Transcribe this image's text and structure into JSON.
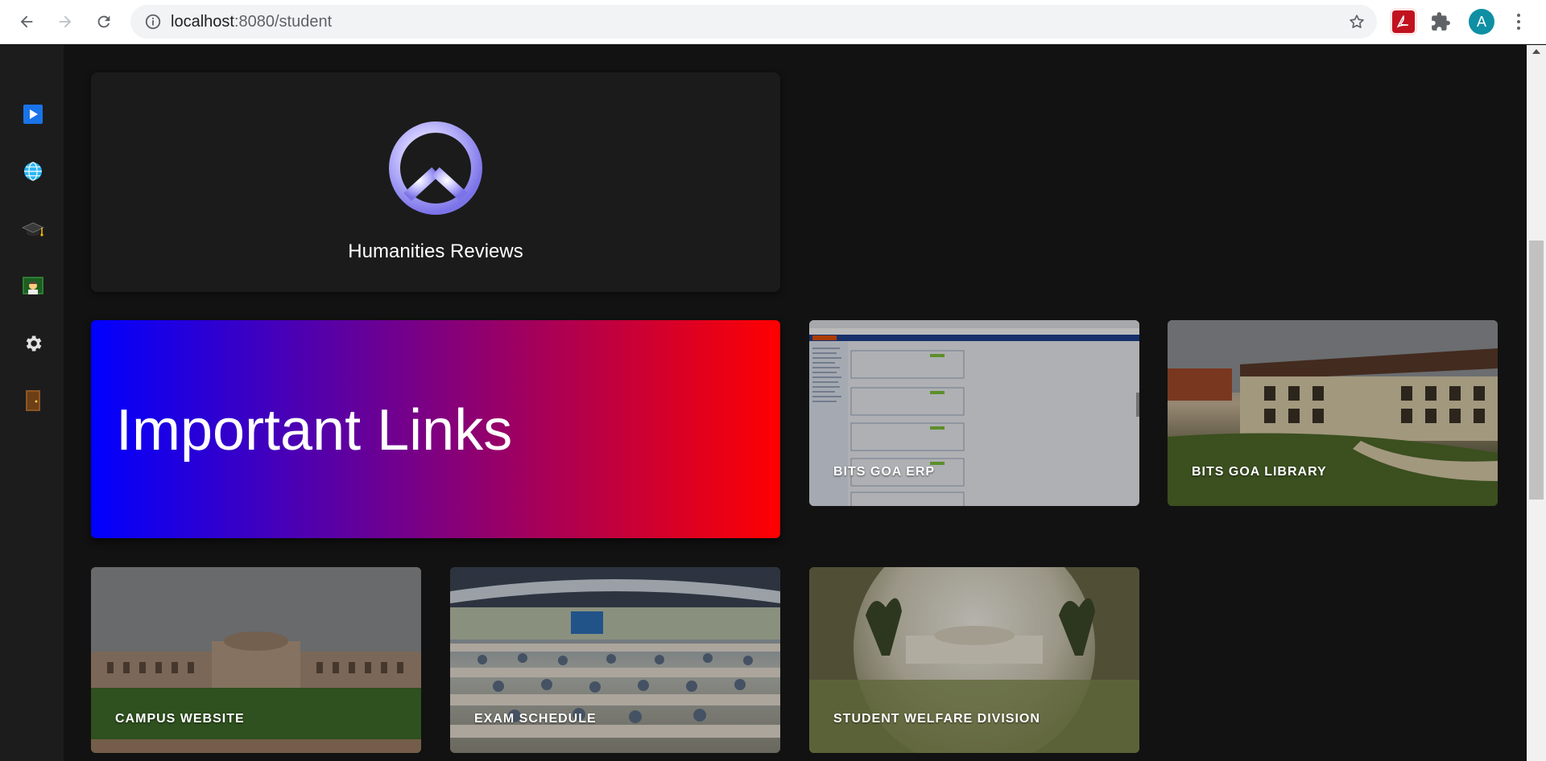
{
  "browser": {
    "url_host": "localhost",
    "url_rest": ":8080/student",
    "avatar_letter": "A",
    "pdf_ext_glyph": "⅄"
  },
  "sidebar": {
    "items": [
      {
        "name": "play-icon",
        "glyph": "▶"
      },
      {
        "name": "globe-icon",
        "glyph": "🌐"
      },
      {
        "name": "graduation-cap-icon",
        "glyph": "🎓"
      },
      {
        "name": "teacher-icon",
        "glyph": "👨‍🏫"
      },
      {
        "name": "gear-icon",
        "glyph": "⚙"
      },
      {
        "name": "door-icon",
        "glyph": "🚪"
      }
    ]
  },
  "humanities": {
    "title": "Humanities Reviews",
    "icon": "peace-icon"
  },
  "important": {
    "title": "Important Links"
  },
  "links": [
    {
      "label": "BITS GOA ERP"
    },
    {
      "label": "BITS GOA LIBRARY"
    },
    {
      "label": "CAMPUS WEBSITE"
    },
    {
      "label": "EXAM SCHEDULE"
    },
    {
      "label": "STUDENT WELFARE DIVISION"
    }
  ],
  "colors": {
    "gradient_start": "#0000ff",
    "gradient_end": "#ff0000",
    "background": "#121212",
    "sidebar": "#1c1c1c"
  }
}
